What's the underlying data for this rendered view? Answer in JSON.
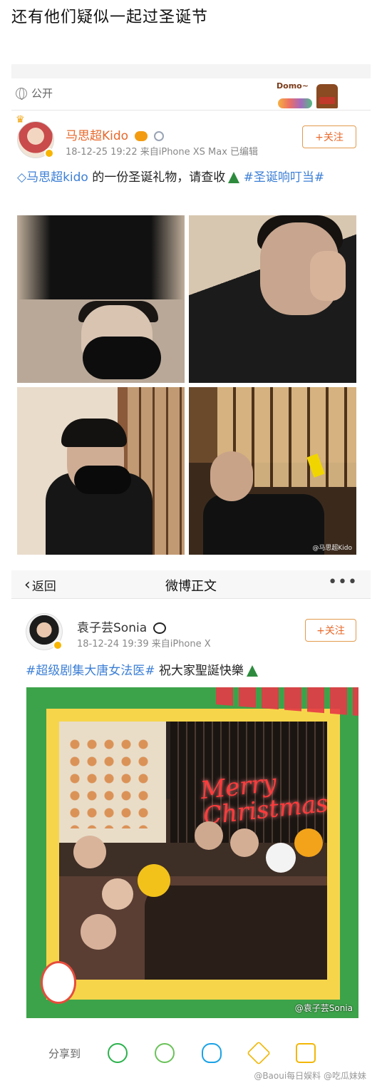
{
  "caption": "还有他们疑似一起过圣诞节",
  "post1": {
    "visibility": "公开",
    "sticker_text": "Domo~",
    "username": "马思超Kido",
    "meta": "18-12-25 19:22  来自iPhone XS Max  已编辑",
    "follow_label": "+关注",
    "text_link_user": "马思超kido",
    "text_body": " 的一份圣诞礼物，请查收",
    "text_hashtag": " #圣诞响叮当#",
    "photo_watermark": "@马思超Kido"
  },
  "post2": {
    "nav": {
      "back_label": "返回",
      "title": "微博正文",
      "more_label": "•••"
    },
    "username": "袁子芸Sonia",
    "meta": "18-12-24 19:39  来自iPhone X",
    "follow_label": "+关注",
    "text_hashtag": "#超级剧集大唐女法医#",
    "text_body": " 祝大家聖誕快樂",
    "image_text_merry": "Merry",
    "image_text_christmas": "Christmas",
    "image_watermark": "@袁子芸Sonia",
    "share_label": "分享到",
    "footer_watermark": "@Baoui每日娱料  @吃瓜妹妹"
  },
  "colors": {
    "accent_orange": "#e8682a",
    "link_blue": "#3c7fd6",
    "frame_green": "#3da34a",
    "frame_yellow": "#f7d54b"
  },
  "icons": [
    "globe-icon",
    "crown-icon",
    "verified-icon",
    "vip-icon",
    "medal-icon",
    "panda-icon",
    "tree-icon",
    "back-arrow-icon",
    "more-icon",
    "wechat-icon",
    "moments-icon",
    "qq-icon",
    "qzone-icon",
    "album-icon"
  ]
}
